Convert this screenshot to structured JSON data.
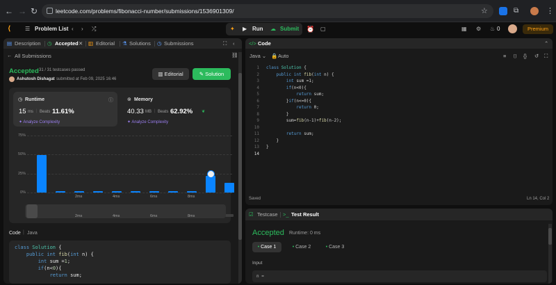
{
  "browser": {
    "url": "leetcode.com/problems/fibonacci-number/submissions/1536901309/"
  },
  "appbar": {
    "problem_list": "Problem List",
    "run": "Run",
    "submit": "Submit",
    "streak": "0",
    "premium": "Premium"
  },
  "left_tabs": [
    {
      "label": "Description"
    },
    {
      "label": "Accepted"
    },
    {
      "label": "Editorial"
    },
    {
      "label": "Solutions"
    },
    {
      "label": "Submissions"
    }
  ],
  "submission": {
    "back": "All Submissions",
    "status": "Accepted",
    "testcases": "31 / 31 testcases passed",
    "author": "Ashutosh Dishagat",
    "submitted": "submitted at Feb 09, 2025 16:46",
    "editorial_btn": "Editorial",
    "solution_btn": "Solution"
  },
  "runtime": {
    "title": "Runtime",
    "value": "15",
    "unit": "ms",
    "beats_label": "Beats",
    "beats": "11.61%",
    "analyze": "Analyze Complexity"
  },
  "memory": {
    "title": "Memory",
    "value": "40.33",
    "unit": "MB",
    "beats_label": "Beats",
    "beats": "62.92%",
    "analyze": "Analyze Complexity"
  },
  "chart_data": {
    "type": "bar",
    "yticks": [
      "75%",
      "50%",
      "25%",
      "0%"
    ],
    "ylim": [
      0,
      75
    ],
    "values": [
      49,
      2,
      2,
      2,
      2,
      2,
      2,
      2,
      2,
      22,
      13
    ],
    "xlabels": [
      "2ms",
      "4ms",
      "6ms",
      "8ms"
    ],
    "mini_xlabels": [
      "2ms",
      "4ms",
      "6ms",
      "8ms"
    ],
    "highlight_index": 10
  },
  "code_section": {
    "title": "Code",
    "lang": "Java"
  },
  "left_code": [
    "class Solution {",
    "    public int fib(int n) {",
    "        int sum =1;",
    "        if(n<0){",
    "            return sum;"
  ],
  "editor": {
    "title": "Code",
    "lang": "Java",
    "auto": "Auto",
    "saved": "Saved",
    "position": "Ln 14, Col 2",
    "lines": [
      "class Solution {",
      "    public int fib(int n) {",
      "        int sum =1;",
      "        if(n<0){",
      "            return sum;",
      "        }if(n<=0){",
      "            return 0;",
      "        }",
      "        sum=fib(n-1)+fib(n-2);",
      "",
      "        return sum;",
      "    }",
      "}",
      ""
    ]
  },
  "testpanel": {
    "tab1": "Testcase",
    "tab2": "Test Result",
    "status": "Accepted",
    "runtime": "Runtime: 0 ms",
    "cases": [
      "Case 1",
      "Case 2",
      "Case 3"
    ],
    "input_label": "Input",
    "input_value": "n ="
  }
}
